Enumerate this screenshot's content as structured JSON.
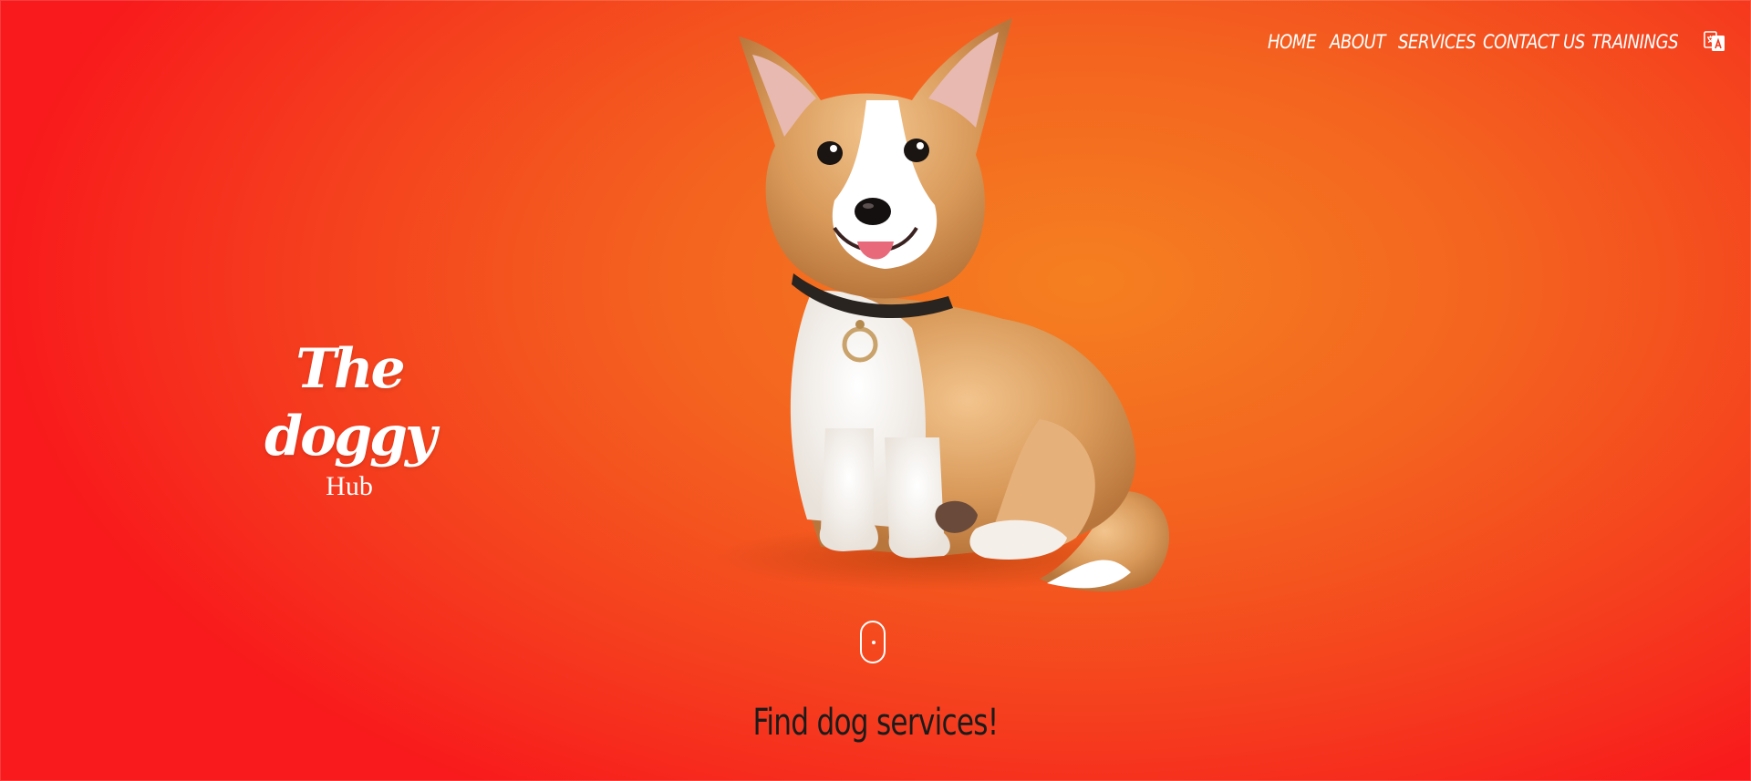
{
  "nav": {
    "items": [
      {
        "label": "HOME"
      },
      {
        "label": "ABOUT"
      },
      {
        "label": "SERVICES"
      },
      {
        "label": "CONTACT US"
      },
      {
        "label": "TRAININGS"
      }
    ],
    "language_icon": "translate-icon"
  },
  "hero": {
    "title": "The doggy",
    "subtitle": "Hub",
    "image": "corgi-puppy-illustration",
    "scroll_icon": "mouse-scroll-icon",
    "cta": "Find dog services!"
  },
  "colors": {
    "background_center": "#f58020",
    "background_edge": "#f81a1c",
    "text_light": "#ffffff",
    "text_dark": "#1b1b1b"
  }
}
